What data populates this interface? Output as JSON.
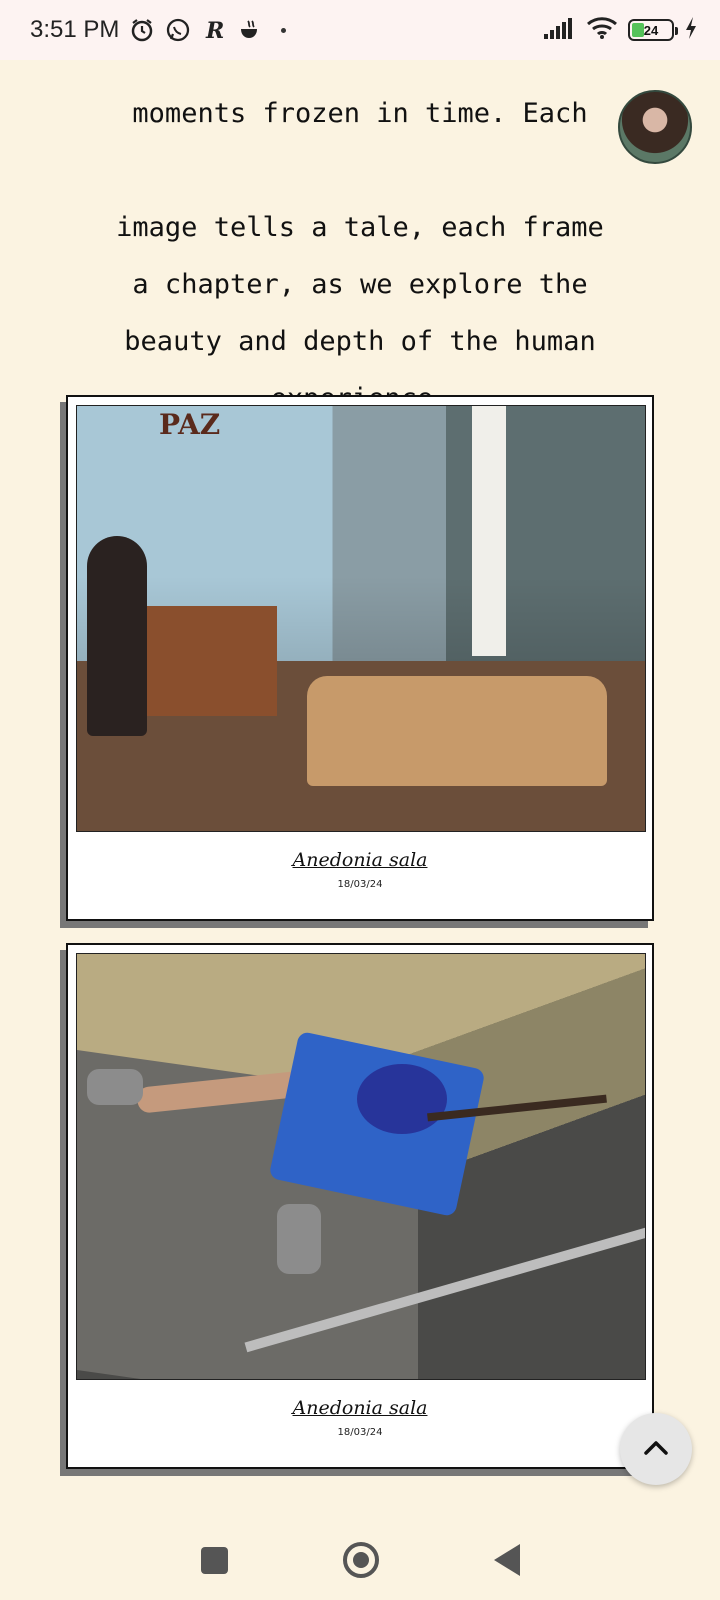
{
  "status_bar": {
    "time": "3:51 PM",
    "battery_level": "24",
    "icons": [
      "alarm-icon",
      "whatsapp-icon",
      "r-app-icon",
      "teacup-icon",
      "notification-dot-icon",
      "signal-icon",
      "wifi-icon",
      "battery-icon",
      "charging-icon"
    ]
  },
  "intro": {
    "partial_top_line": "moments frozen in time. Each",
    "text": "image tells a tale, each frame\na chapter, as we explore the\nbeauty and depth of the human\nexperience."
  },
  "avatar": {
    "alt": "profile avatar"
  },
  "photos": [
    {
      "caption": "Anedonia sala",
      "date": "18/03/24",
      "wall_text": "PAZ"
    },
    {
      "caption": "Anedonia sala",
      "date": "18/03/24"
    }
  ],
  "fab": {
    "icon": "chevron-up-icon"
  },
  "nav": {
    "icons": [
      "recents-square-icon",
      "home-circle-icon",
      "back-triangle-icon"
    ]
  }
}
